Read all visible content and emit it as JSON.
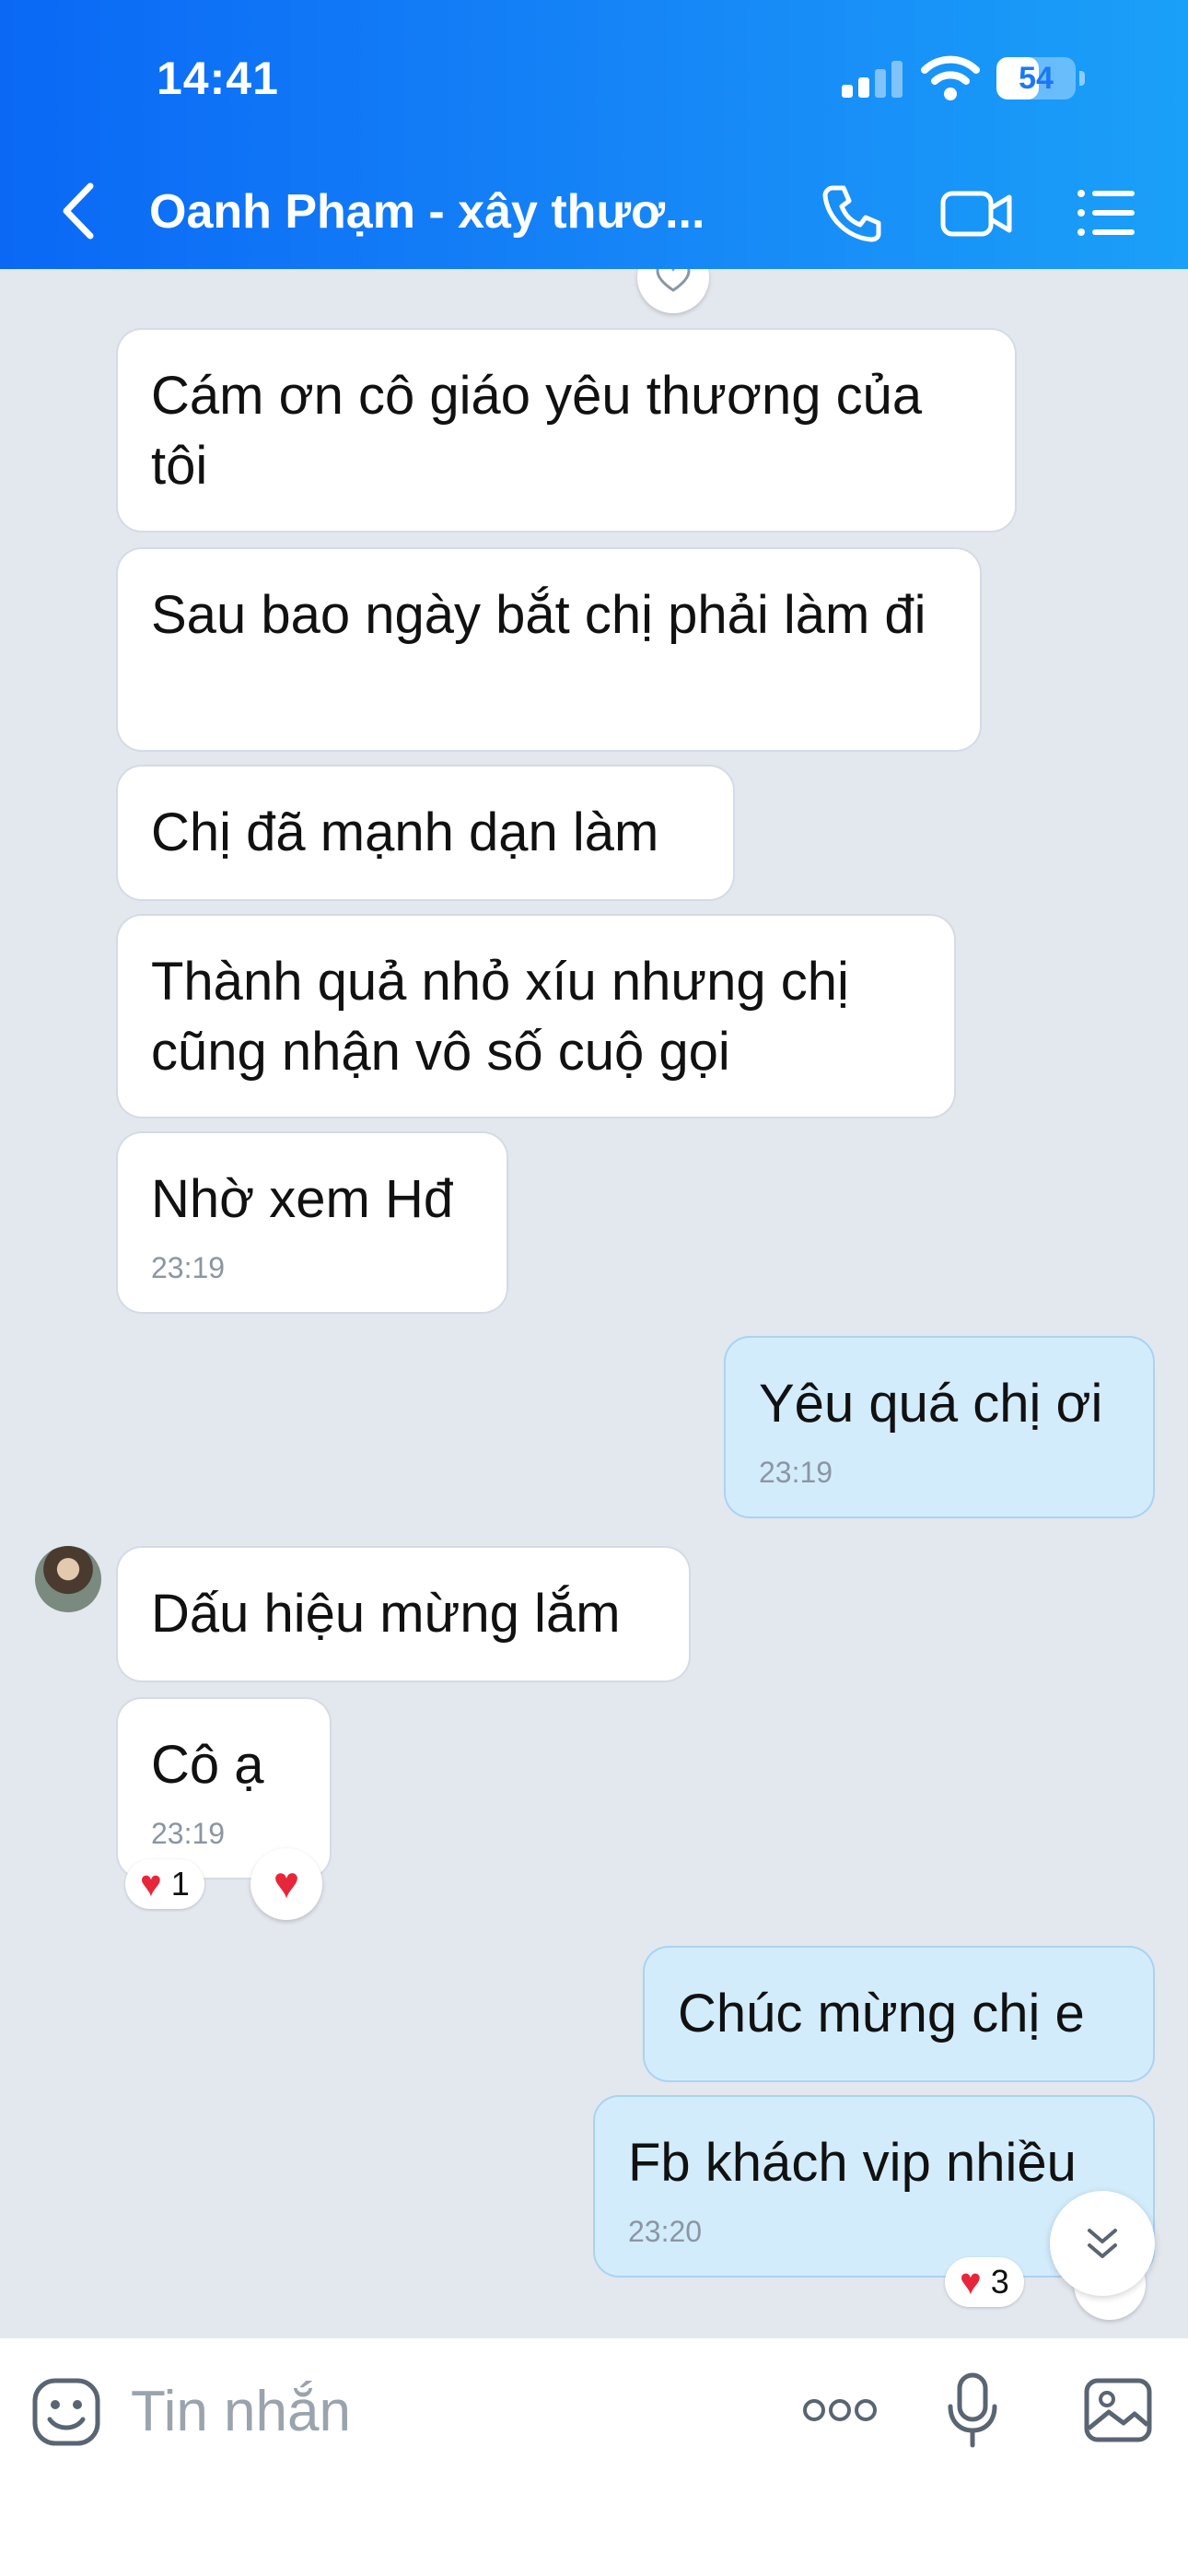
{
  "status_bar": {
    "time": "14:41",
    "battery": "54",
    "battery_level": 0.54
  },
  "header": {
    "title": "Oanh Phạm - xây thươ...",
    "icons": [
      "back-arrow-icon",
      "phone-icon",
      "video-call-icon",
      "menu-list-icon"
    ]
  },
  "messages": [
    {
      "direction": "received",
      "text": "Cám ơn cô giáo yêu thương của tôi"
    },
    {
      "direction": "received",
      "text": "Sau bao ngày bắt chị phải làm đi"
    },
    {
      "direction": "received",
      "text": "Chị đã mạnh dạn làm"
    },
    {
      "direction": "received",
      "text": "Thành quả nhỏ xíu nhưng chị cũng nhận vô số cuộ gọi"
    },
    {
      "direction": "received",
      "text": "Nhờ xem Hđ",
      "time": "23:19"
    },
    {
      "direction": "sent",
      "text": "Yêu quá chị ơi",
      "time": "23:19"
    },
    {
      "direction": "received",
      "text": "Dấu hiệu mừng lắm"
    },
    {
      "direction": "received",
      "text": "Cô ạ",
      "time": "23:19",
      "reaction_count": "1"
    },
    {
      "direction": "sent",
      "text": "Chúc mừng chị e"
    },
    {
      "direction": "sent",
      "text": "Fb khách vip nhiều",
      "time": "23:20",
      "reaction_count": "3"
    }
  ],
  "input": {
    "placeholder": "Tin nhắn"
  },
  "colors": {
    "header_start": "#0a68f5",
    "header_end": "#1aa0f8",
    "sent_bubble": "#d3ecfc",
    "chat_bg": "#e3e7ee",
    "heart": "#e8263a"
  }
}
